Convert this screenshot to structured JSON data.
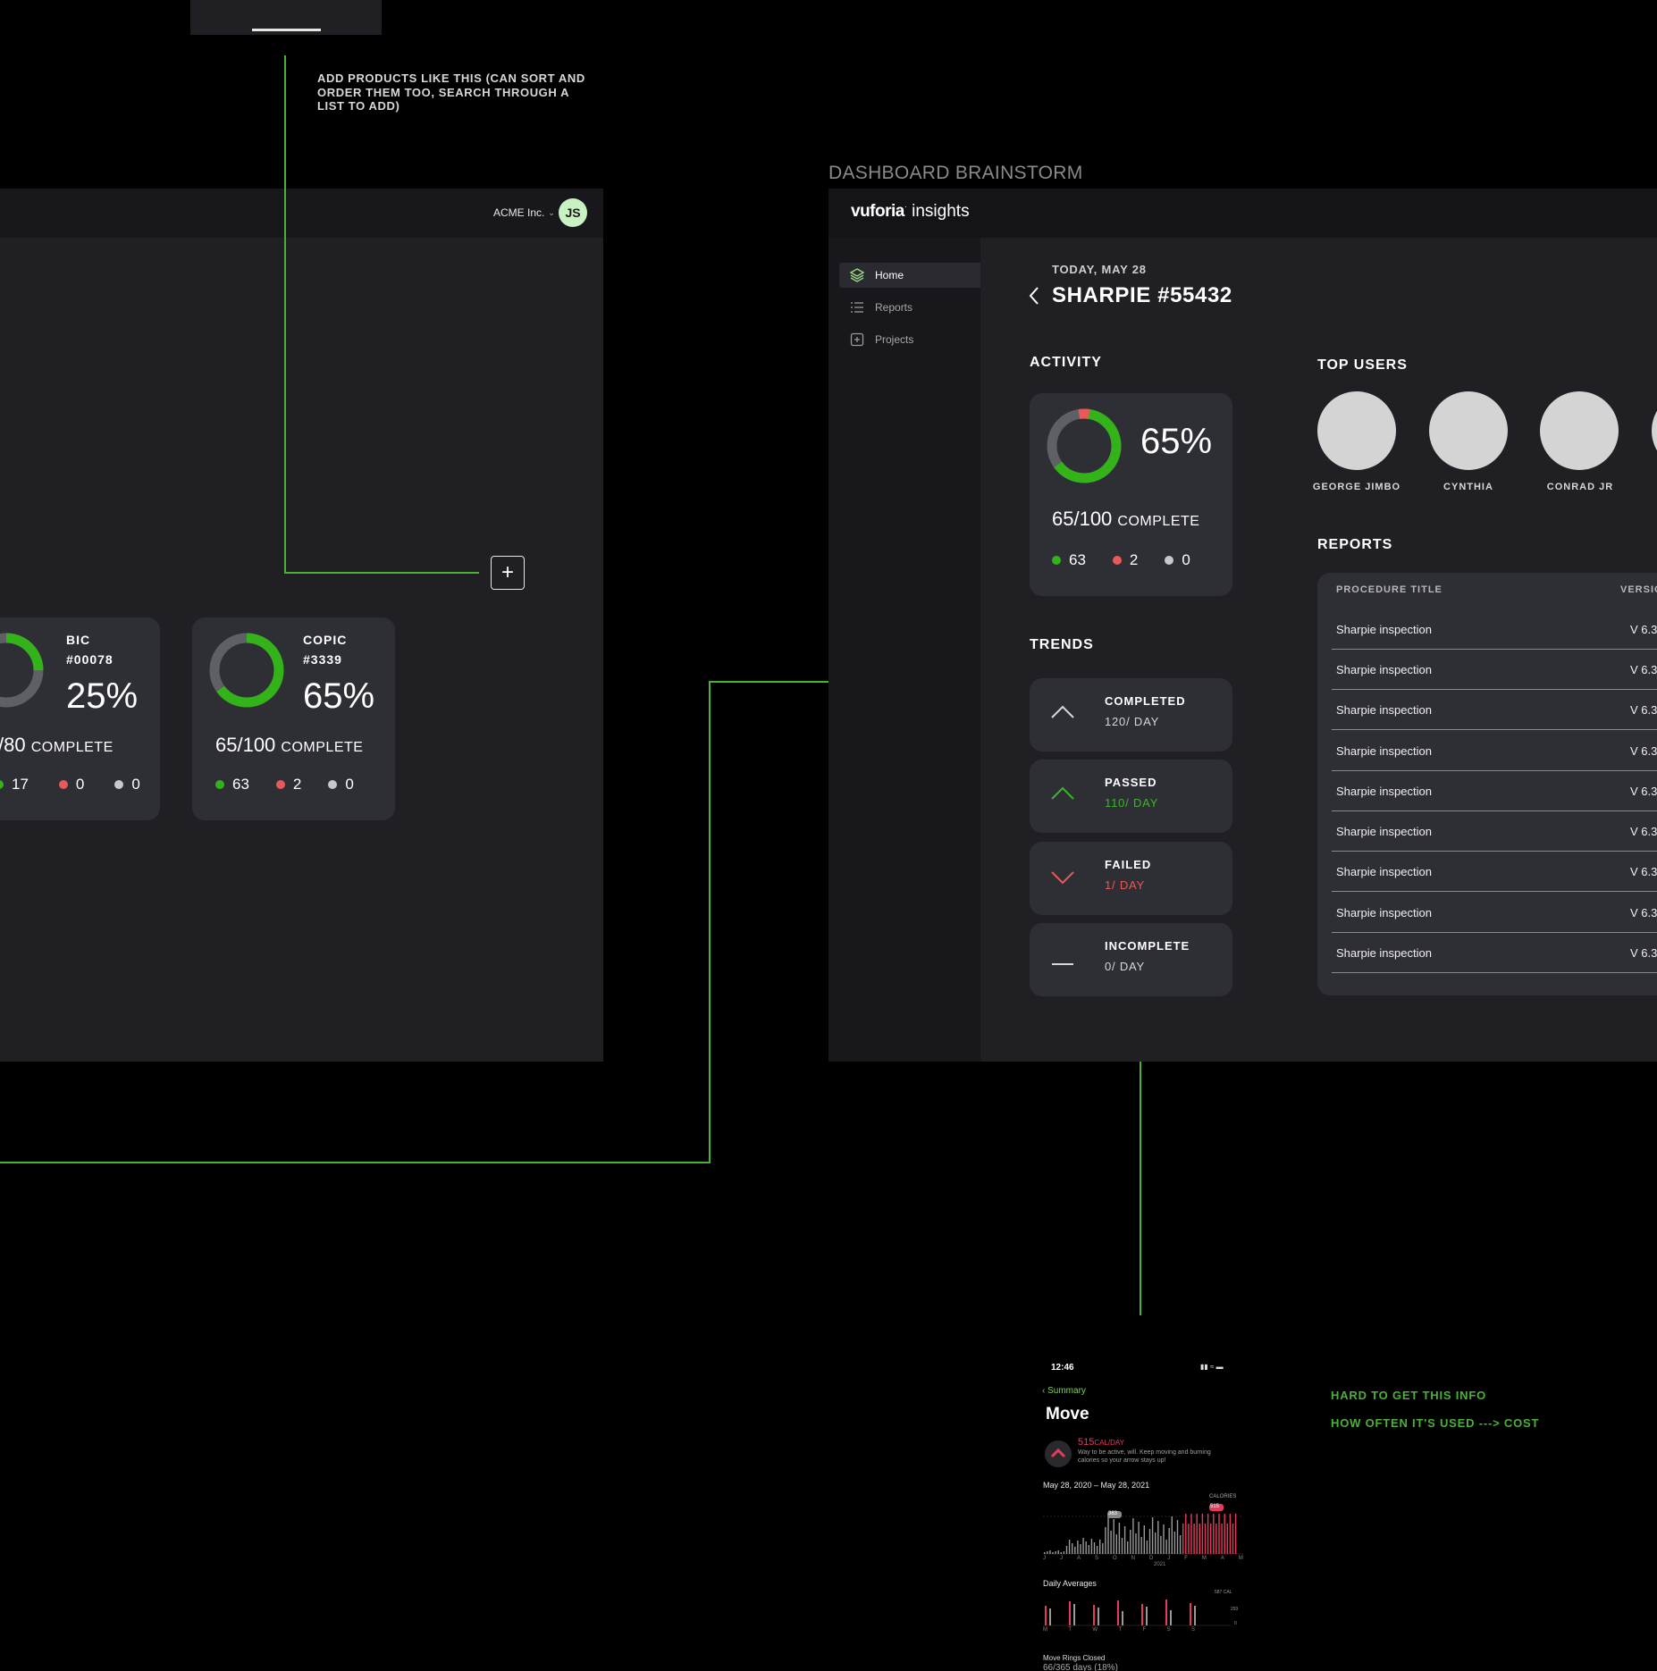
{
  "annotations": {
    "add_products_note": "ADD PRODUCTS LIKE THIS (CAN SORT AND ORDER THEM TOO, SEARCH THROUGH A LIST TO ADD)",
    "hard_info": "HARD TO GET THIS INFO",
    "cost_note": "HOW OFTEN IT'S USED ---> COST",
    "brainstorm": "DASHBOARD BRAINSTORM"
  },
  "left_app": {
    "org_name": "ACME Inc.",
    "avatar_initials": "JS",
    "add_button_glyph": "+",
    "products": [
      {
        "name_line1": "BIC",
        "name_line2": "#00078",
        "percent": "25%",
        "progress": 0.25,
        "complete_count": "/80",
        "complete_word": "COMPLETE",
        "passed": "17",
        "failed": "0",
        "incomplete": "0"
      },
      {
        "name_line1": "COPIC",
        "name_line2": "#3339",
        "percent": "65%",
        "progress": 0.65,
        "complete_count": "65/100",
        "complete_word": "COMPLETE",
        "passed": "63",
        "failed": "2",
        "incomplete": "0"
      }
    ]
  },
  "dashboard": {
    "logo_brand": "vuforia",
    "logo_product": "insights",
    "nav": [
      {
        "label": "Home",
        "icon": "layers-icon",
        "active": true
      },
      {
        "label": "Reports",
        "icon": "list-icon",
        "active": false
      },
      {
        "label": "Projects",
        "icon": "add-box-icon",
        "active": false
      }
    ],
    "date": "TODAY, MAY 28",
    "title": "SHARPIE #55432",
    "activity": {
      "heading": "ACTIVITY",
      "percent": "65%",
      "progress": 0.65,
      "failed_fraction": 0.05,
      "complete_count": "65/100",
      "complete_word": "COMPLETE",
      "passed": "63",
      "failed": "2",
      "incomplete": "0"
    },
    "trends": {
      "heading": "TRENDS",
      "items": [
        {
          "label": "COMPLETED",
          "value": "120/ DAY",
          "color": "#d8d8d8",
          "icon": "chevron-up-icon"
        },
        {
          "label": "PASSED",
          "value": "110/ DAY",
          "color": "#3cb52a",
          "icon": "chevron-up-icon"
        },
        {
          "label": "FAILED",
          "value": "1/ DAY",
          "color": "#e85a5a",
          "icon": "chevron-down-icon"
        },
        {
          "label": "INCOMPLETE",
          "value": "0/ DAY",
          "color": "#d8d8d8",
          "icon": "dash-icon"
        }
      ]
    },
    "top_users": {
      "heading": "TOP USERS",
      "users": [
        "GEORGE JIMBO",
        "CYNTHIA",
        "CONRAD JR"
      ]
    },
    "reports": {
      "heading": "REPORTS",
      "col_title": "PROCEDURE TITLE",
      "col_version": "VERSIO",
      "rows": [
        {
          "title": "Sharpie inspection",
          "version": "V 6.3"
        },
        {
          "title": "Sharpie inspection",
          "version": "V 6.3"
        },
        {
          "title": "Sharpie inspection",
          "version": "V 6.3"
        },
        {
          "title": "Sharpie inspection",
          "version": "V 6.3"
        },
        {
          "title": "Sharpie inspection",
          "version": "V 6.3"
        },
        {
          "title": "Sharpie inspection",
          "version": "V 6.3"
        },
        {
          "title": "Sharpie inspection",
          "version": "V 6.3"
        },
        {
          "title": "Sharpie inspection",
          "version": "V 6.3"
        },
        {
          "title": "Sharpie inspection",
          "version": "V 6.3"
        }
      ]
    }
  },
  "phone": {
    "time": "12:46",
    "back_label": "Summary",
    "title": "Move",
    "goal_value": "515",
    "goal_unit": "CAL/DAY",
    "goal_desc_1": "Way to be active, will. Keep moving and burning",
    "goal_desc_2": "calories so your arrow stays up!",
    "date_range": "May 28, 2020 – May 28, 2021",
    "calories_label": "CALORIES",
    "marker_old": "383",
    "marker_new": "515",
    "month_labels": [
      "J",
      "J",
      "A",
      "S",
      "O",
      "N",
      "D",
      "J",
      "F",
      "M",
      "A",
      "M"
    ],
    "year_label": "2021",
    "daily_averages": "Daily Averages",
    "avg_high": "587 CAL",
    "avg_mid": "293",
    "avg_low": "0",
    "day_labels": [
      "M",
      "T",
      "W",
      "T",
      "F",
      "S",
      "S"
    ],
    "rings_label": "Move Rings Closed",
    "rings_value": "66/365 days (18%)"
  }
}
